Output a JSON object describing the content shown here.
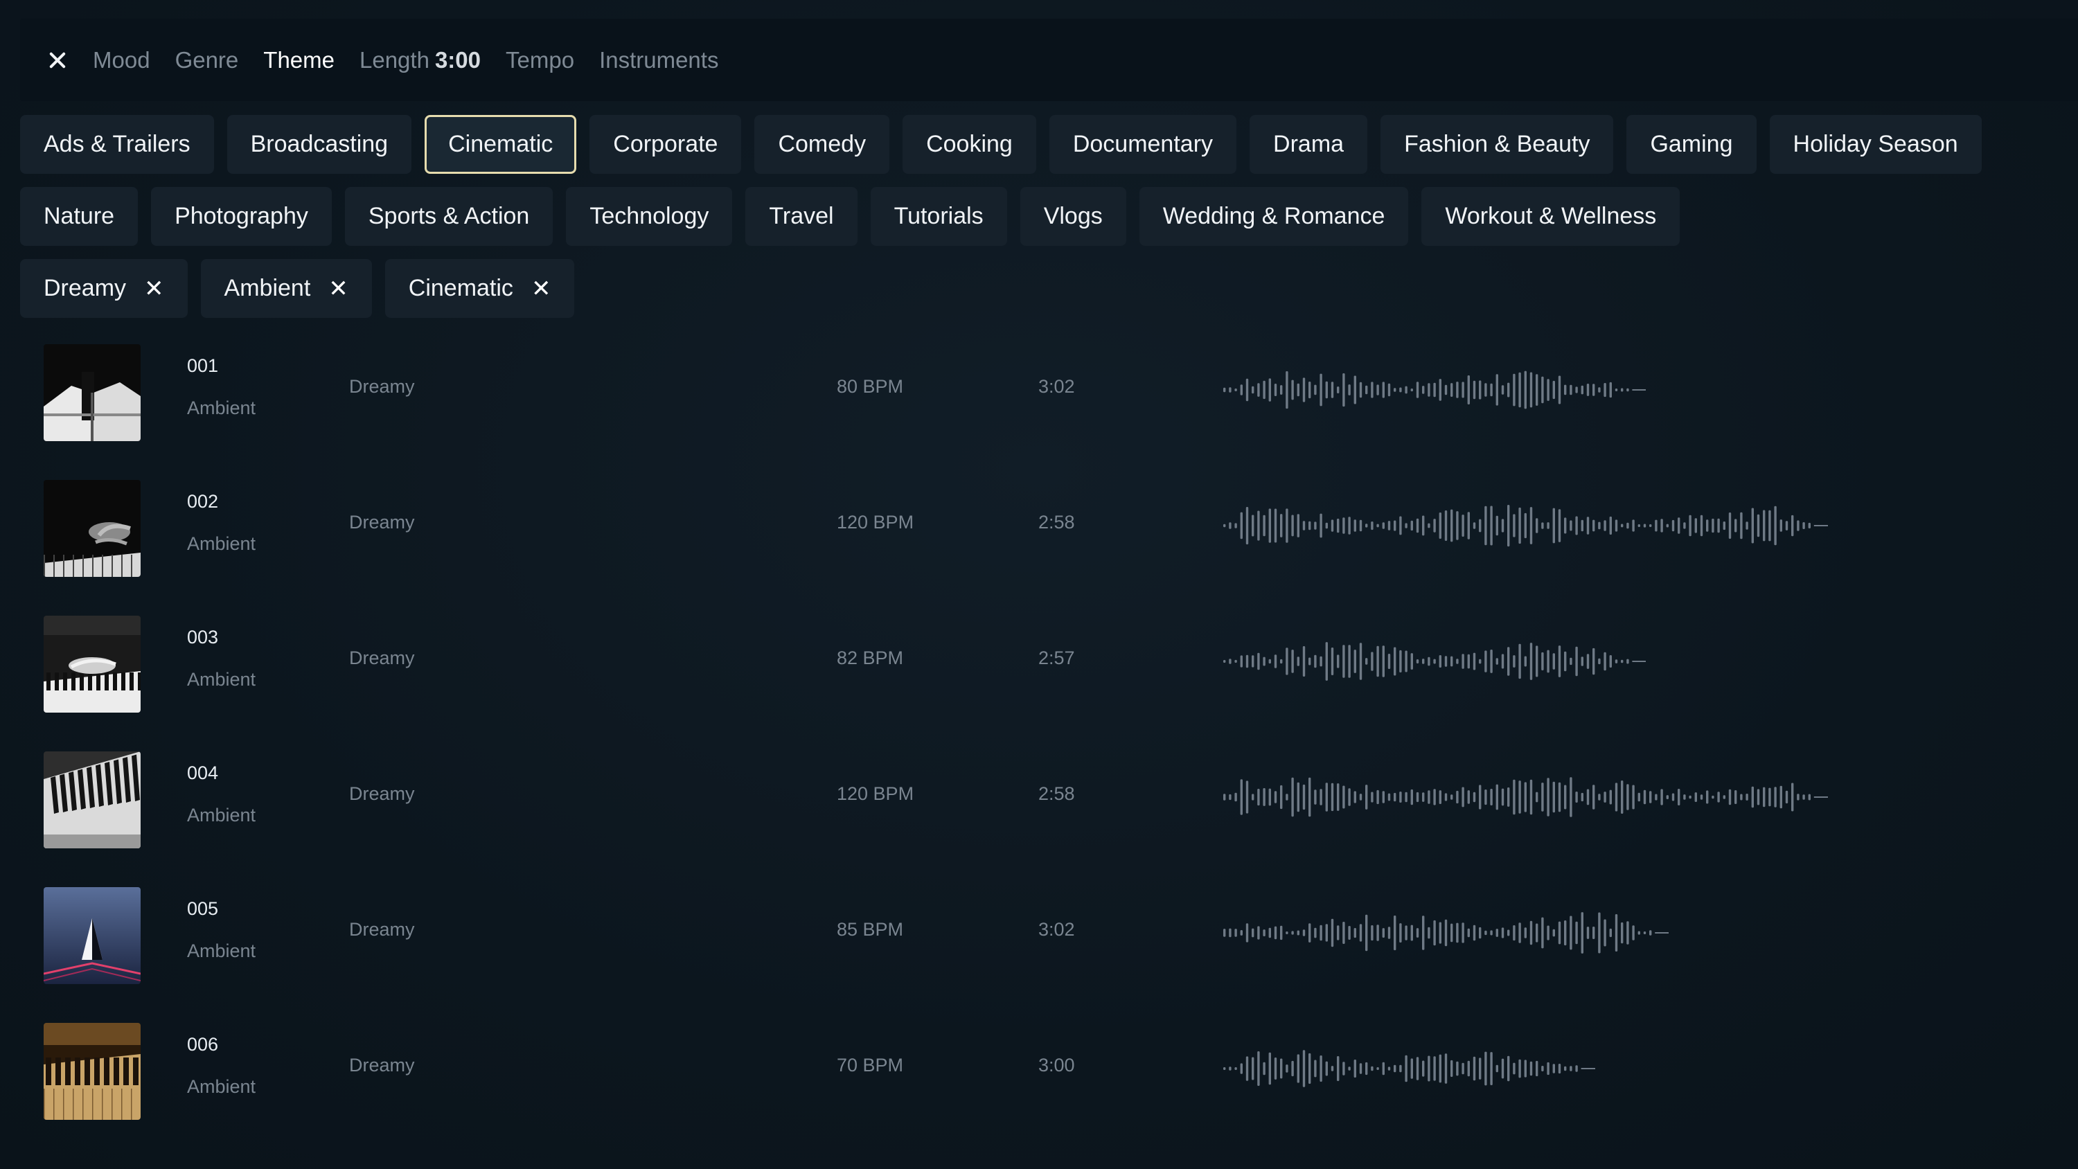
{
  "toolbar": {
    "tabs": [
      {
        "label": "Mood"
      },
      {
        "label": "Genre"
      },
      {
        "label": "Theme",
        "active": true
      },
      {
        "label": "Length",
        "value": "3:00"
      },
      {
        "label": "Tempo"
      },
      {
        "label": "Instruments"
      }
    ]
  },
  "themes": {
    "row1": [
      "Ads & Trailers",
      "Broadcasting",
      "Cinematic",
      "Corporate",
      "Comedy",
      "Cooking",
      "Documentary",
      "Drama",
      "Fashion & Beauty",
      "Gaming",
      "Holiday Season"
    ],
    "row2": [
      "Nature",
      "Photography",
      "Sports & Action",
      "Technology",
      "Travel",
      "Tutorials",
      "Vlogs",
      "Wedding & Romance",
      "Workout & Wellness"
    ],
    "selected": "Cinematic"
  },
  "active_filters": [
    "Dreamy",
    "Ambient",
    "Cinematic"
  ],
  "colors": {
    "background": "#0d1720",
    "chip": "#16212b",
    "selected_border": "#e6dcae",
    "waveform": "#6f7a86",
    "muted_text": "#7a8590"
  },
  "tracks": [
    {
      "number": "001",
      "genre": "Ambient",
      "mood": "Dreamy",
      "bpm": "80 BPM",
      "duration": "3:02",
      "thumbnail": "piano-keys-closeup"
    },
    {
      "number": "002",
      "genre": "Ambient",
      "mood": "Dreamy",
      "bpm": "120 BPM",
      "duration": "2:58",
      "thumbnail": "hands-on-piano-dark"
    },
    {
      "number": "003",
      "genre": "Ambient",
      "mood": "Dreamy",
      "bpm": "82 BPM",
      "duration": "2:57",
      "thumbnail": "hands-playing-piano"
    },
    {
      "number": "004",
      "genre": "Ambient",
      "mood": "Dreamy",
      "bpm": "120 BPM",
      "duration": "2:58",
      "thumbnail": "piano-keys-angle"
    },
    {
      "number": "005",
      "genre": "Ambient",
      "mood": "Dreamy",
      "bpm": "85 BPM",
      "duration": "3:02",
      "thumbnail": "glass-pyramid-blue"
    },
    {
      "number": "006",
      "genre": "Ambient",
      "mood": "Dreamy",
      "bpm": "70 BPM",
      "duration": "3:00",
      "thumbnail": "golden-piano-keys"
    }
  ]
}
